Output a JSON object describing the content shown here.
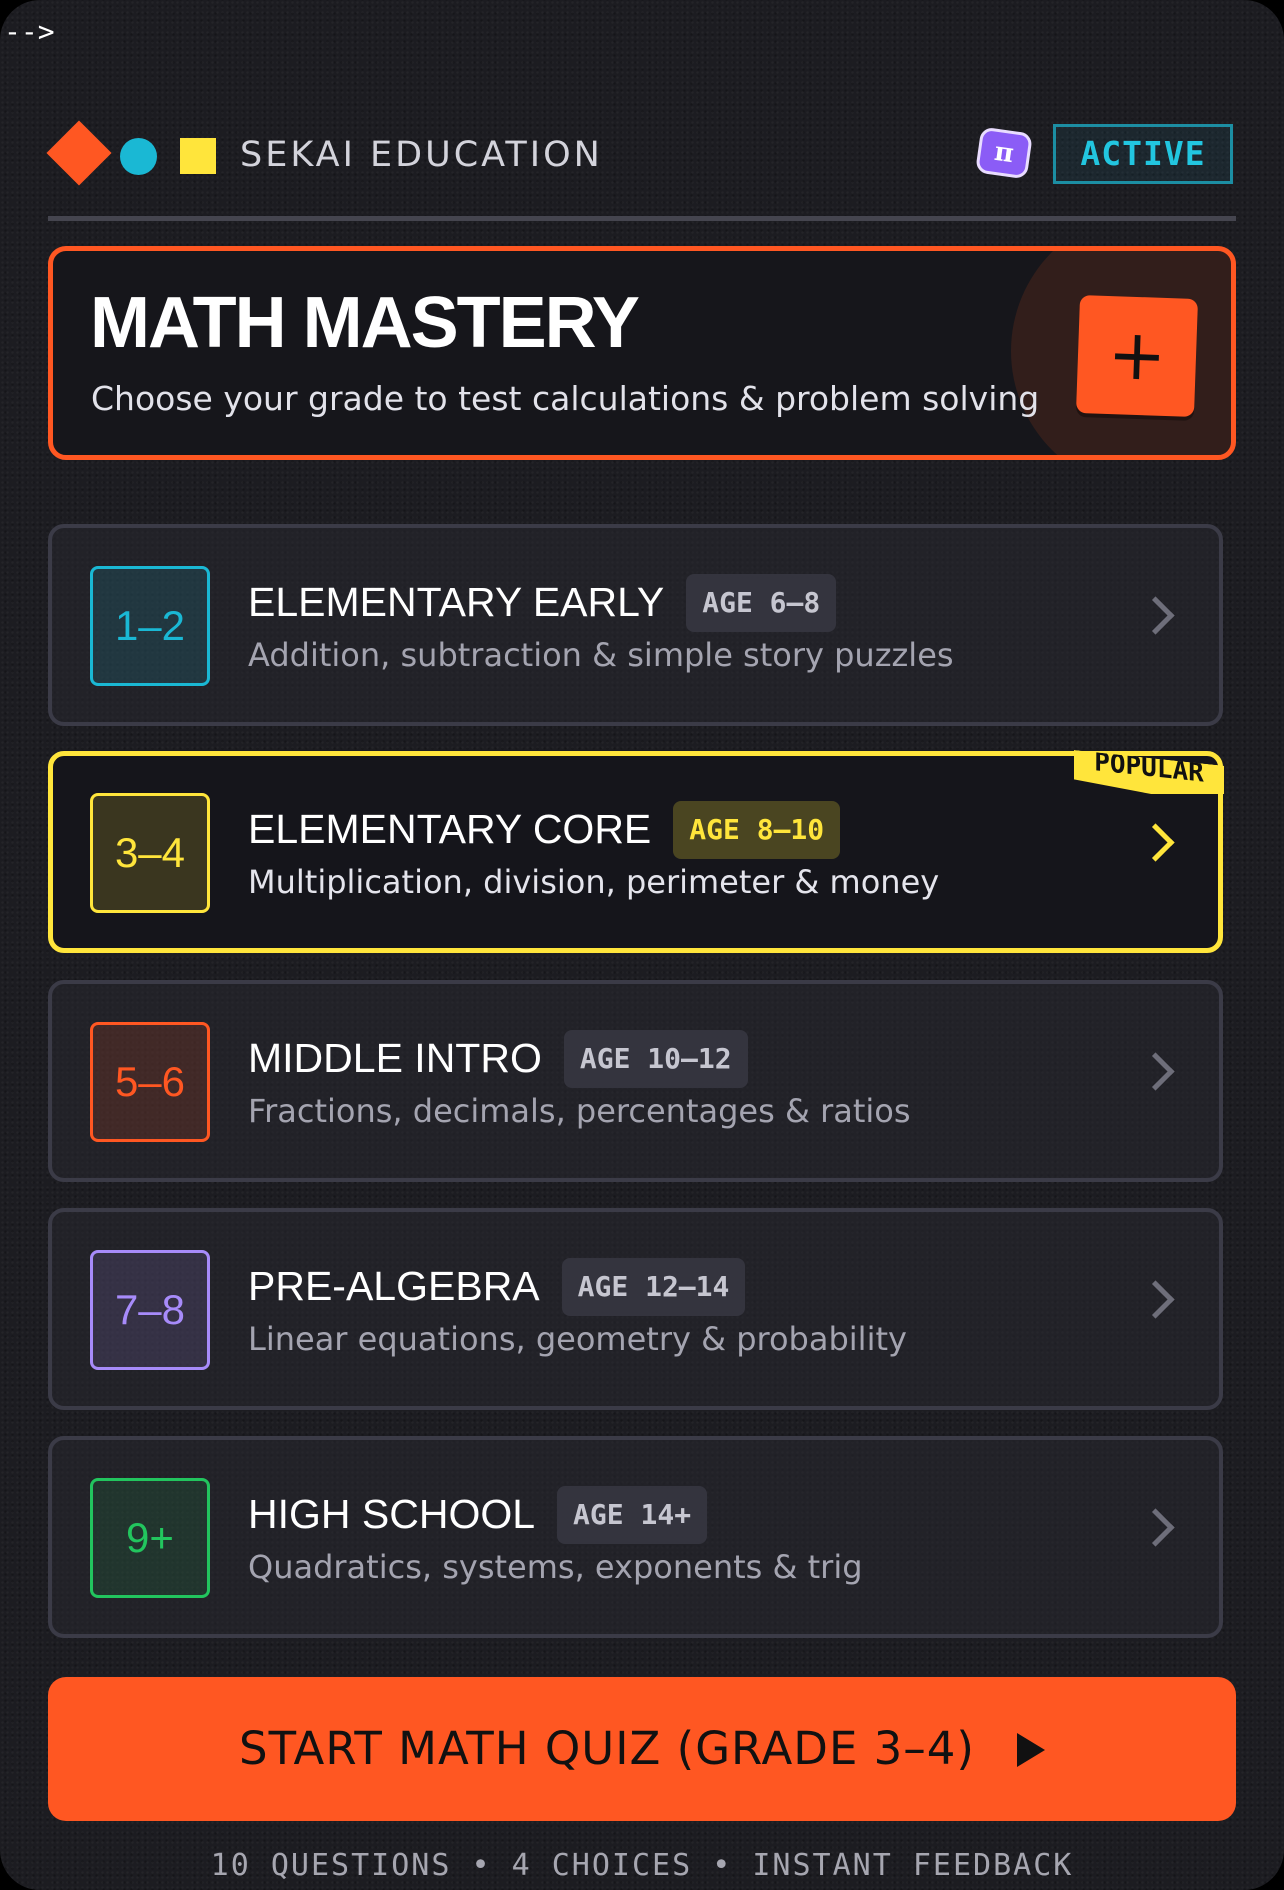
{
  "corner_code": "-->",
  "header": {
    "brand": "SEKAI EDUCATION",
    "pi_symbol": "π",
    "status": "ACTIVE",
    "shapes": [
      "orange-diamond",
      "cyan-circle",
      "yellow-square"
    ]
  },
  "hero": {
    "title": "MATH MASTERY",
    "subtitle": "Choose your grade to test calculations & problem solving",
    "action_symbol": "+"
  },
  "grades": [
    {
      "grade": "1–2",
      "title": "ELEMENTARY EARLY",
      "age": "AGE 6–8",
      "description": "Addition, subtraction & simple story puzzles",
      "accent": "#1ab8d4",
      "selected": false
    },
    {
      "grade": "3–4",
      "title": "ELEMENTARY CORE",
      "age": "AGE 8–10",
      "description": "Multiplication, division, perimeter & money",
      "accent": "#ffe53b",
      "selected": true,
      "ribbon": "POPULAR"
    },
    {
      "grade": "5–6",
      "title": "MIDDLE INTRO",
      "age": "AGE 10–12",
      "description": "Fractions, decimals, percentages & ratios",
      "accent": "#ff5722",
      "selected": false
    },
    {
      "grade": "7–8",
      "title": "PRE-ALGEBRA",
      "age": "AGE 12–14",
      "description": "Linear equations, geometry & probability",
      "accent": "#a78bfa",
      "selected": false
    },
    {
      "grade": "9+",
      "title": "HIGH SCHOOL",
      "age": "AGE 14+",
      "description": "Quadratics, systems, exponents & trig",
      "accent": "#22c55e",
      "selected": false
    }
  ],
  "cta": {
    "label": "START MATH QUIZ (GRADE 3–4)"
  },
  "footer": {
    "note": "10 QUESTIONS • 4 CHOICES • INSTANT FEEDBACK"
  },
  "colors": {
    "accent": "#ff5722",
    "highlight": "#ffe53b",
    "status": "#22c6e0",
    "background": "#1c1c21"
  }
}
